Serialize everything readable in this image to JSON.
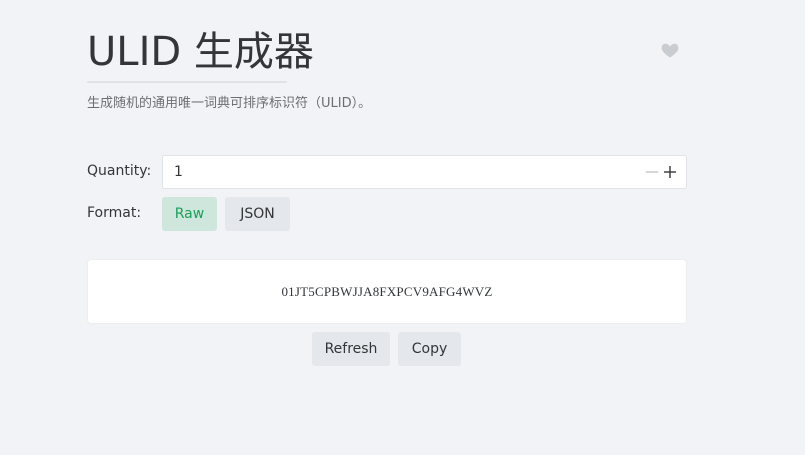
{
  "header": {
    "title": "ULID 生成器",
    "subtitle": "生成随机的通用唯一词典可排序标识符（ULID）。",
    "favorite_icon": "heart-icon"
  },
  "form": {
    "quantity_label": "Quantity:",
    "quantity_value": "1",
    "format_label": "Format:",
    "formats": [
      {
        "label": "Raw",
        "selected": true
      },
      {
        "label": "JSON",
        "selected": false
      }
    ]
  },
  "result": {
    "value": "01JT5CPBWJJA8FXPCV9AFG4WVZ"
  },
  "actions": {
    "refresh_label": "Refresh",
    "copy_label": "Copy"
  },
  "colors": {
    "background": "#f1f3f7",
    "accent": "#18a058",
    "accent_bg": "#cfe6dc",
    "button_bg": "#e4e7eb"
  }
}
